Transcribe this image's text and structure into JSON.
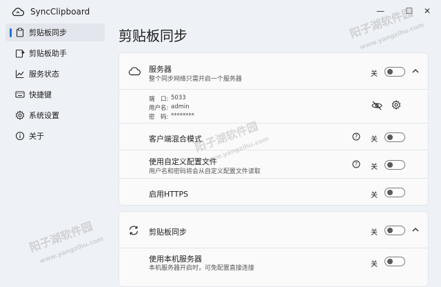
{
  "app": {
    "title": "SyncClipboard"
  },
  "window": {
    "minimize": "—",
    "maximize": "☐",
    "close": "✕"
  },
  "sidebar": {
    "items": [
      {
        "label": "剪贴板同步"
      },
      {
        "label": "剪贴板助手"
      },
      {
        "label": "服务状态"
      },
      {
        "label": "快捷键"
      },
      {
        "label": "系统设置"
      },
      {
        "label": "关于"
      }
    ]
  },
  "main": {
    "title": "剪贴板同步",
    "server_card": {
      "title": "服务器",
      "subtitle": "整个同步网络只需开启一个服务器",
      "toggle_label": "关",
      "toggle_on": false,
      "port_label": "端　口:",
      "port_value": "5033",
      "username_label": "用户名:",
      "username_value": "admin",
      "password_label": "密　码:",
      "password_value": "********",
      "rows": [
        {
          "title": "客户端混合模式",
          "subtitle": "",
          "toggle_label": "关",
          "has_help": true
        },
        {
          "title": "使用自定义配置文件",
          "subtitle": "用户名和密码将会从自定义配置文件读取",
          "toggle_label": "关",
          "has_help": true
        },
        {
          "title": "启用HTTPS",
          "subtitle": "",
          "toggle_label": "关",
          "has_help": false
        }
      ]
    },
    "sync_card": {
      "title": "剪贴板同步",
      "toggle_label": "关",
      "rows": [
        {
          "title": "使用本机服务器",
          "subtitle": "本机服务器开启时，可免配置直接连接",
          "toggle_label": "关"
        }
      ]
    }
  },
  "watermark": {
    "text": "阳子湖软件园",
    "url": "www.yangzihu.com"
  },
  "colors": {
    "accent": "#2a6fd6",
    "background": "#eef1f6",
    "card": "#fafafb"
  },
  "icons": [
    "cloud-sync-icon",
    "clipboard-icon",
    "clipboard-helper-icon",
    "chart-icon",
    "keyboard-icon",
    "gear-icon",
    "info-icon",
    "cloud-icon",
    "chevron-up-icon",
    "eye-off-icon",
    "settings-icon",
    "help-icon",
    "sync-icon"
  ]
}
